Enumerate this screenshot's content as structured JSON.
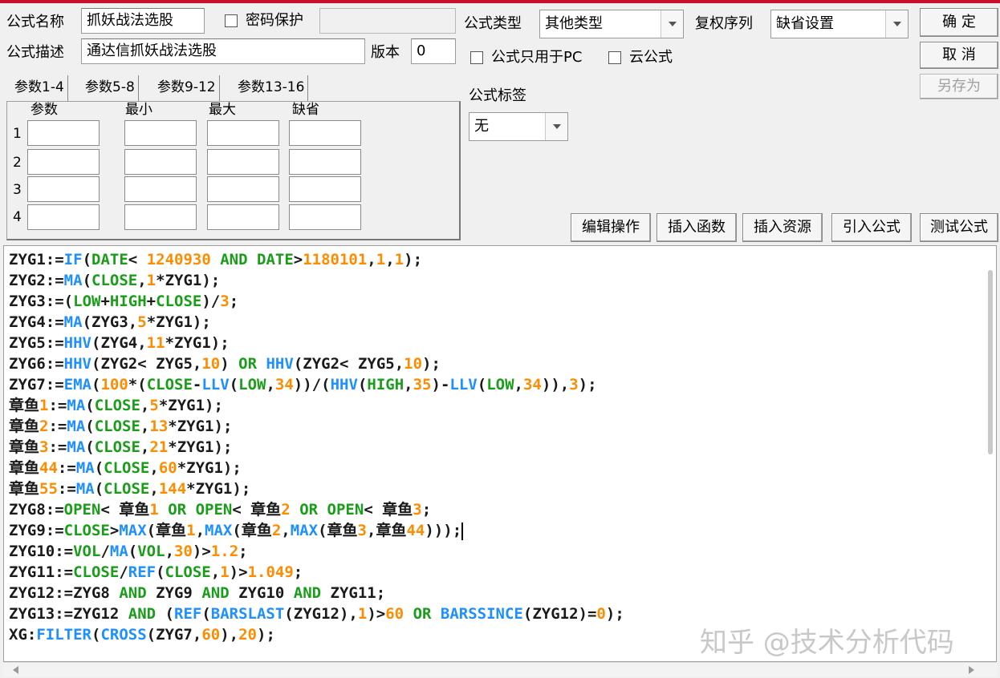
{
  "colors": {
    "keyword": "#1e90ff",
    "number": "#ff8c00",
    "variable": "#1a1a1a",
    "function_green": "#1a9e1a",
    "accent_topline": "#c8102e"
  },
  "header": {
    "formula_name_label": "公式名称",
    "formula_name_value": "抓妖战法选股",
    "password_label": "密码保护",
    "password_value": "",
    "formula_desc_label": "公式描述",
    "formula_desc_value": "通达信抓妖战法选股",
    "version_label": "版本",
    "version_value": "0",
    "formula_type_label": "公式类型",
    "formula_type_value": "其他类型",
    "rights_label": "复权序列",
    "rights_value": "缺省设置",
    "pc_only_label": "公式只用于PC",
    "cloud_label": "云公式",
    "tag_label": "公式标签",
    "tag_value": "无"
  },
  "buttons": {
    "ok": "确 定",
    "cancel": "取 消",
    "save_as": "另存为",
    "edit_ops": "编辑操作",
    "insert_func": "插入函数",
    "insert_resource": "插入资源",
    "import_formula": "引入公式",
    "test_formula": "测试公式"
  },
  "tabs": [
    "参数1-4",
    "参数5-8",
    "参数9-12",
    "参数13-16"
  ],
  "params": {
    "headers": [
      "参数",
      "最小",
      "最大",
      "缺省"
    ],
    "rows": [
      "1",
      "2",
      "3",
      "4"
    ]
  },
  "code_lines": [
    "ZYG1:=IF(DATE< 1240930 AND DATE>1180101,1,1);",
    "ZYG2:=MA(CLOSE,1*ZYG1);",
    "ZYG3:=(LOW+HIGH+CLOSE)/3;",
    "ZYG4:=MA(ZYG3,5*ZYG1);",
    "ZYG5:=HHV(ZYG4,11*ZYG1);",
    "ZYG6:=HHV(ZYG2< ZYG5,10) OR HHV(ZYG2< ZYG5,10);",
    "ZYG7:=EMA(100*(CLOSE-LLV(LOW,34))/(HHV(HIGH,35)-LLV(LOW,34)),3);",
    "章鱼1:=MA(CLOSE,5*ZYG1);",
    "章鱼2:=MA(CLOSE,13*ZYG1);",
    "章鱼3:=MA(CLOSE,21*ZYG1);",
    "章鱼44:=MA(CLOSE,60*ZYG1);",
    "章鱼55:=MA(CLOSE,144*ZYG1);",
    "ZYG8:=OPEN< 章鱼1 OR OPEN< 章鱼2 OR OPEN< 章鱼3;",
    "ZYG9:=CLOSE>MAX(章鱼1,MAX(章鱼2,MAX(章鱼3,章鱼44)));",
    "ZYG10:=VOL/MA(VOL,30)>1.2;",
    "ZYG11:=CLOSE/REF(CLOSE,1)>1.049;",
    "ZYG12:=ZYG8 AND ZYG9 AND ZYG10 AND ZYG11;",
    "ZYG13:=ZYG12 AND (REF(BARSLAST(ZYG12),1)>60 OR BARSSINCE(ZYG12)=0);",
    "XG:FILTER(CROSS(ZYG7,60),20);"
  ],
  "watermark": "知乎 @技术分析代码"
}
